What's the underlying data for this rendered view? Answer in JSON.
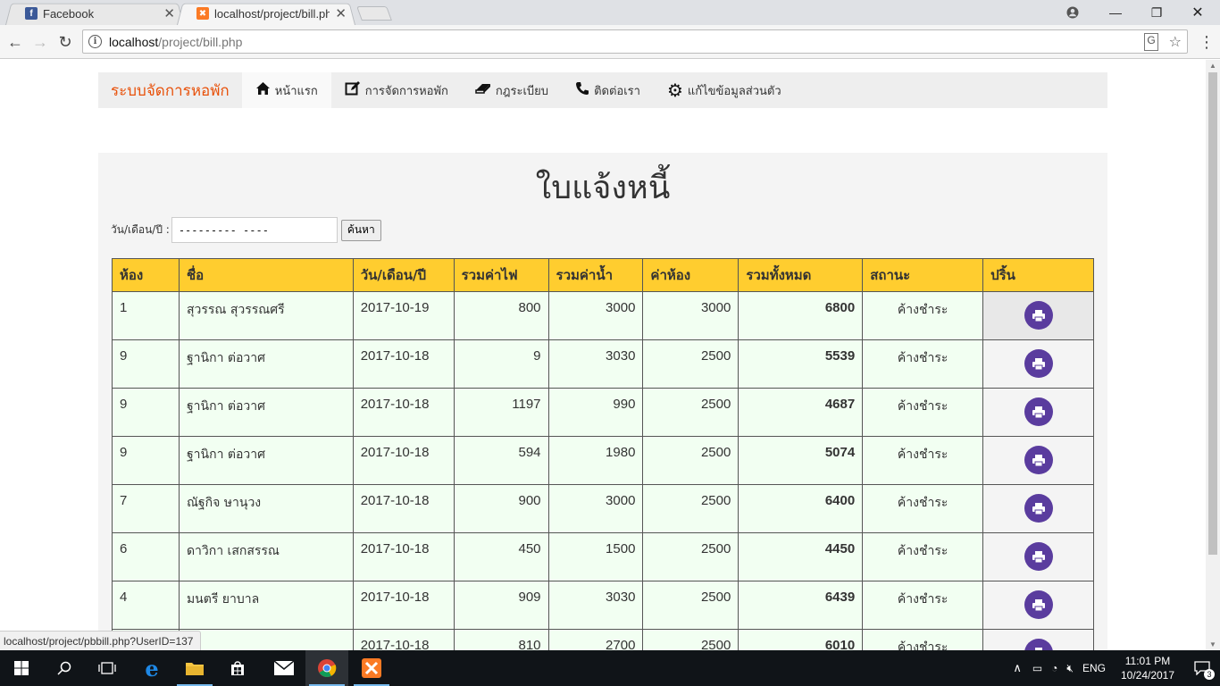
{
  "browser": {
    "tabs": [
      {
        "title": "Facebook",
        "favicon": "facebook-icon",
        "active": false
      },
      {
        "title": "localhost/project/bill.php",
        "favicon": "xampp-icon",
        "active": true
      }
    ],
    "url_host": "localhost",
    "url_path": "/project/bill.php",
    "status_url": "localhost/project/pbbill.php?UserID=137"
  },
  "nav": {
    "brand": "ระบบจัดการหอพัก",
    "items": [
      {
        "label": "หน้าแรก",
        "icon": "home-icon"
      },
      {
        "label": "การจัดการหอพัก",
        "icon": "edit-icon"
      },
      {
        "label": "กฎระเบียบ",
        "icon": "eraser-icon"
      },
      {
        "label": "ติดต่อเรา",
        "icon": "phone-icon"
      },
      {
        "label": "แก้ไขข้อมูลส่วนตัว",
        "icon": "gear-icon"
      }
    ]
  },
  "page": {
    "title": "ใบแจ้งหนี้",
    "search_label": "วัน/เดือน/ปี :",
    "search_value": "--------- ----",
    "search_button": "ค้นหา"
  },
  "table": {
    "headers": [
      "ห้อง",
      "ชื่อ",
      "วัน/เดือน/ปี",
      "รวมค่าไฟ",
      "รวมค่าน้ำ",
      "ค่าห้อง",
      "รวมทั้งหมด",
      "สถานะ",
      "ปริ้น"
    ],
    "rows": [
      {
        "room": "1",
        "name": "สุวรรณ สุวรรณศรี",
        "date": "2017-10-19",
        "electric": "800",
        "water": "3000",
        "rent": "3000",
        "total": "6800",
        "status": "ค้างชำระ"
      },
      {
        "room": "9",
        "name": "ฐานิกา ต่อวาศ",
        "date": "2017-10-18",
        "electric": "9",
        "water": "3030",
        "rent": "2500",
        "total": "5539",
        "status": "ค้างชำระ"
      },
      {
        "room": "9",
        "name": "ฐานิกา ต่อวาศ",
        "date": "2017-10-18",
        "electric": "1197",
        "water": "990",
        "rent": "2500",
        "total": "4687",
        "status": "ค้างชำระ"
      },
      {
        "room": "9",
        "name": "ฐานิกา ต่อวาศ",
        "date": "2017-10-18",
        "electric": "594",
        "water": "1980",
        "rent": "2500",
        "total": "5074",
        "status": "ค้างชำระ"
      },
      {
        "room": "7",
        "name": "ณัฐกิจ ษานุวง",
        "date": "2017-10-18",
        "electric": "900",
        "water": "3000",
        "rent": "2500",
        "total": "6400",
        "status": "ค้างชำระ"
      },
      {
        "room": "6",
        "name": "ดาวิกา เสกสรรณ",
        "date": "2017-10-18",
        "electric": "450",
        "water": "1500",
        "rent": "2500",
        "total": "4450",
        "status": "ค้างชำระ"
      },
      {
        "room": "4",
        "name": "มนตรี ยาบาล",
        "date": "2017-10-18",
        "electric": "909",
        "water": "3030",
        "rent": "2500",
        "total": "6439",
        "status": "ค้างชำระ"
      },
      {
        "room": "",
        "name": "",
        "date": "2017-10-18",
        "electric": "810",
        "water": "2700",
        "rent": "2500",
        "total": "6010",
        "status": "ค้างชำระ"
      }
    ]
  },
  "taskbar": {
    "time": "11:01 PM",
    "date": "10/24/2017",
    "language": "ENG",
    "notification_count": "3"
  },
  "colors": {
    "brand": "#e8510a",
    "table_header": "#ffcd2f",
    "row_bg": "#f2fff2",
    "print_button": "#5a3c9e"
  }
}
